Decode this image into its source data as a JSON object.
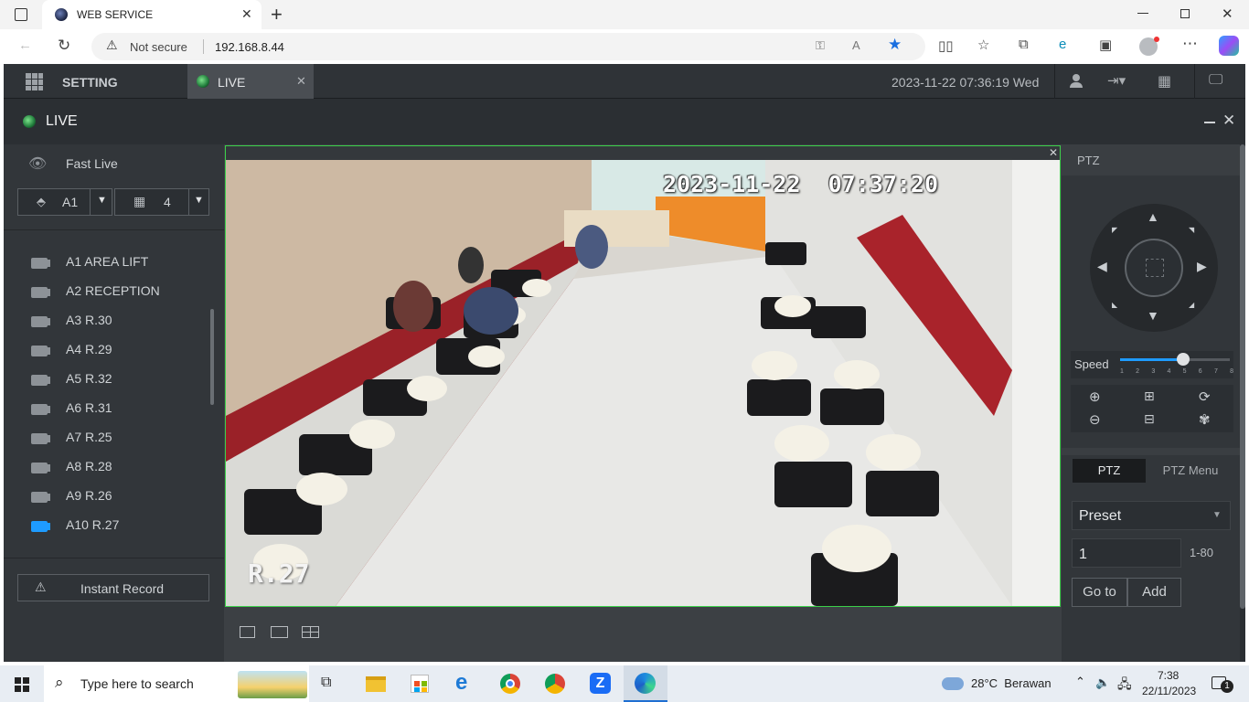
{
  "browser": {
    "tab_title": "WEB SERVICE",
    "security_label": "Not secure",
    "url": "192.168.8.44"
  },
  "app": {
    "nav": {
      "setting_label": "SETTING",
      "live_tab_label": "LIVE",
      "datetime": "2023-11-22 07:36:19 Wed"
    },
    "live_title": "LIVE",
    "left": {
      "fast_live_label": "Fast Live",
      "area_select": "A1",
      "layout_select": "4",
      "cameras": [
        {
          "label": "A1 AREA LIFT",
          "active": false
        },
        {
          "label": "A2 RECEPTION",
          "active": false
        },
        {
          "label": "A3 R.30",
          "active": false
        },
        {
          "label": "A4 R.29",
          "active": false
        },
        {
          "label": "A5 R.32",
          "active": false
        },
        {
          "label": "A6 R.31",
          "active": false
        },
        {
          "label": "A7 R.25",
          "active": false
        },
        {
          "label": "A8 R.28",
          "active": false
        },
        {
          "label": "A9 R.26",
          "active": false
        },
        {
          "label": "A10 R.27",
          "active": true
        }
      ],
      "instant_record_label": "Instant Record"
    },
    "video": {
      "osd_timestamp": "2023-11-22  07:37:20",
      "osd_channel": "R.27"
    },
    "ptz": {
      "header": "PTZ",
      "speed_label": "Speed",
      "speed_ticks": [
        "1",
        "2",
        "3",
        "4",
        "5",
        "6",
        "7",
        "8"
      ],
      "speed_value": 5,
      "tab_ptz": "PTZ",
      "tab_ptz_menu": "PTZ Menu",
      "preset_select": "Preset",
      "preset_value": "1",
      "preset_range": "1-80",
      "goto_label": "Go to",
      "add_label": "Add"
    }
  },
  "taskbar": {
    "search_placeholder": "Type here to search",
    "weather": "28°C  Berawan",
    "time": "7:38",
    "date": "22/11/2023",
    "notification_count": "1"
  },
  "colors": {
    "accent_green": "#3cd04a",
    "active_blue": "#1e9bff",
    "panel_bg": "#32363a",
    "edge_blue": "#1f6fd1"
  }
}
